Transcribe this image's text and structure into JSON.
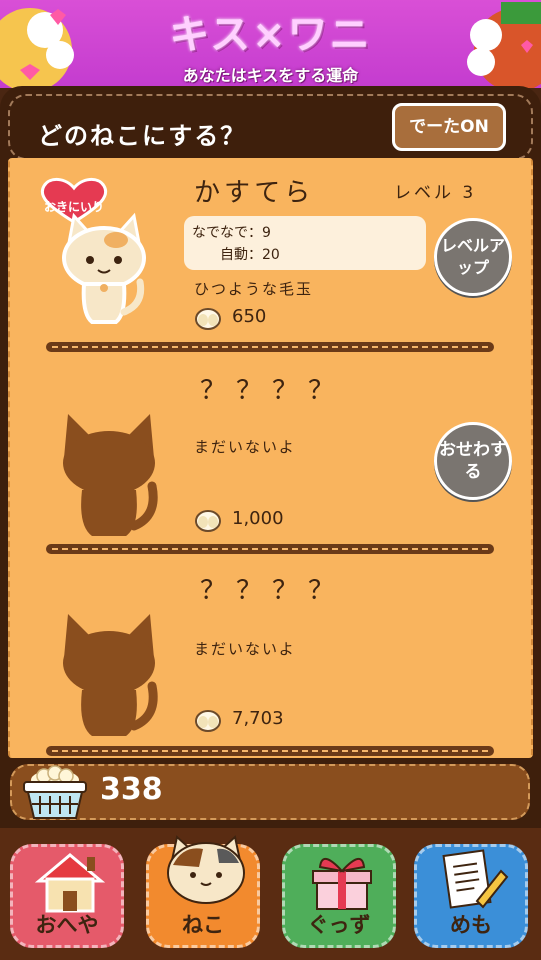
{
  "banner": {
    "logo": "キス×ワニ",
    "subtitle": "あなたはキスをする運命"
  },
  "panel": {
    "title": "どのねこにする？",
    "data_button": "でーたON"
  },
  "cats": [
    {
      "name": "かすてら",
      "level": "レベル 3",
      "favorite_badge": "おきにいり",
      "stat_pet": "なでなで：9",
      "stat_auto": "自動：20",
      "item": "ひつような毛玉",
      "cost": "650",
      "action": "レベルアップ"
    },
    {
      "name": "？？？？",
      "status": "まだいないよ",
      "cost": "1,000",
      "action": "おせわする"
    },
    {
      "name": "？？？？",
      "status": "まだいないよ",
      "cost": "7,703"
    }
  ],
  "counter": {
    "value": "338"
  },
  "nav": {
    "home": "おへや",
    "cats": "ねこ",
    "goods": "ぐっず",
    "memo": "めも"
  },
  "colors": {
    "list_bg": "#f9b45e",
    "panel_bg": "#3e1f0c",
    "nav_home": "#e55a6a",
    "nav_cat": "#f28a2e",
    "nav_goods": "#4fae5a",
    "nav_memo": "#3b8fd8"
  }
}
